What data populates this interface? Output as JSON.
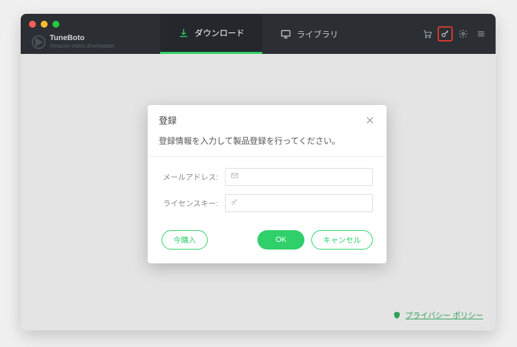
{
  "brand": {
    "name": "TuneBoto",
    "sub": "Amazon video downloader"
  },
  "tabs": {
    "download": "ダウンロード",
    "library": "ライブラリ"
  },
  "modal": {
    "title": "登録",
    "subtitle": "登録情報を入力して製品登録を行ってください。",
    "email_label": "メールアドレス:",
    "email_placeholder": "",
    "license_label": "ライセンスキー:",
    "license_placeholder": "",
    "buy_label": "今購入",
    "ok_label": "OK",
    "cancel_label": "キャンセル"
  },
  "footer": {
    "privacy": "プライバシー ポリシー"
  }
}
